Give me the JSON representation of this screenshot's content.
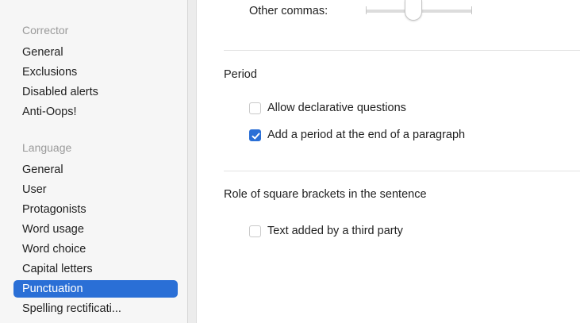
{
  "sidebar": {
    "corrector_title": "Corrector",
    "corrector_items": [
      "General",
      "Exclusions",
      "Disabled alerts",
      "Anti-Oops!"
    ],
    "language_title": "Language",
    "language_items": [
      "General",
      "User",
      "Protagonists",
      "Word usage",
      "Word choice",
      "Capital letters",
      "Punctuation",
      "Spelling rectificati..."
    ],
    "selected_item": "Punctuation"
  },
  "main": {
    "other_commas_label": "Other commas:",
    "period_title": "Period",
    "allow_declarative_label": "Allow declarative questions",
    "allow_declarative_checked": false,
    "add_period_label": "Add a period at the end of a paragraph",
    "add_period_checked": true,
    "brackets_title": "Role of square brackets in the sentence",
    "third_party_label": "Text added by a third party",
    "third_party_checked": false
  },
  "colors": {
    "accent": "#2a6fd6",
    "sidebar_bg": "#f6f6f6",
    "section_title": "#9a9a9a"
  }
}
